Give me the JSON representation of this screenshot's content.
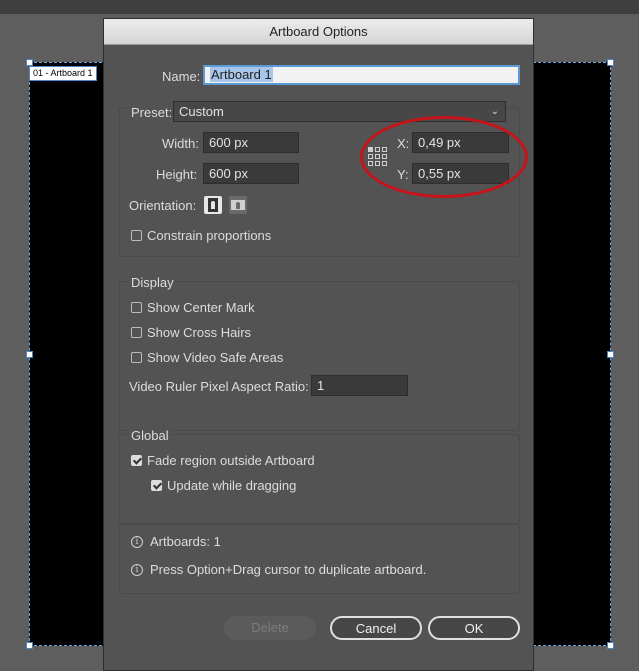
{
  "canvas": {
    "artboard_label": "01 - Artboard 1"
  },
  "dialog": {
    "title": "Artboard Options",
    "name_label": "Name:",
    "name_value": "Artboard 1",
    "preset_label": "Preset:",
    "preset_value": "Custom",
    "width_label": "Width:",
    "width_value": "600 px",
    "height_label": "Height:",
    "height_value": "600 px",
    "x_label": "X:",
    "x_value": "0,49 px",
    "y_label": "Y:",
    "y_value": "0,55 px",
    "orientation_label": "Orientation:",
    "constrain_label": "Constrain proportions",
    "constrain_checked": false,
    "display": {
      "title": "Display",
      "center_mark": "Show Center Mark",
      "cross_hairs": "Show Cross Hairs",
      "video_safe": "Show Video Safe Areas",
      "ratio_label": "Video Ruler Pixel Aspect Ratio:",
      "ratio_value": "1"
    },
    "global": {
      "title": "Global",
      "fade_label": "Fade region outside Artboard",
      "fade_checked": true,
      "update_label": "Update while dragging",
      "update_checked": true
    },
    "info": {
      "artboards": "Artboards: 1",
      "tip": "Press Option+Drag cursor to duplicate artboard."
    },
    "buttons": {
      "delete": "Delete",
      "cancel": "Cancel",
      "ok": "OK"
    }
  },
  "colors": {
    "highlight_circle": "#c8131a",
    "dialog_bg": "#535353",
    "focus_ring": "#5b9bd5"
  }
}
